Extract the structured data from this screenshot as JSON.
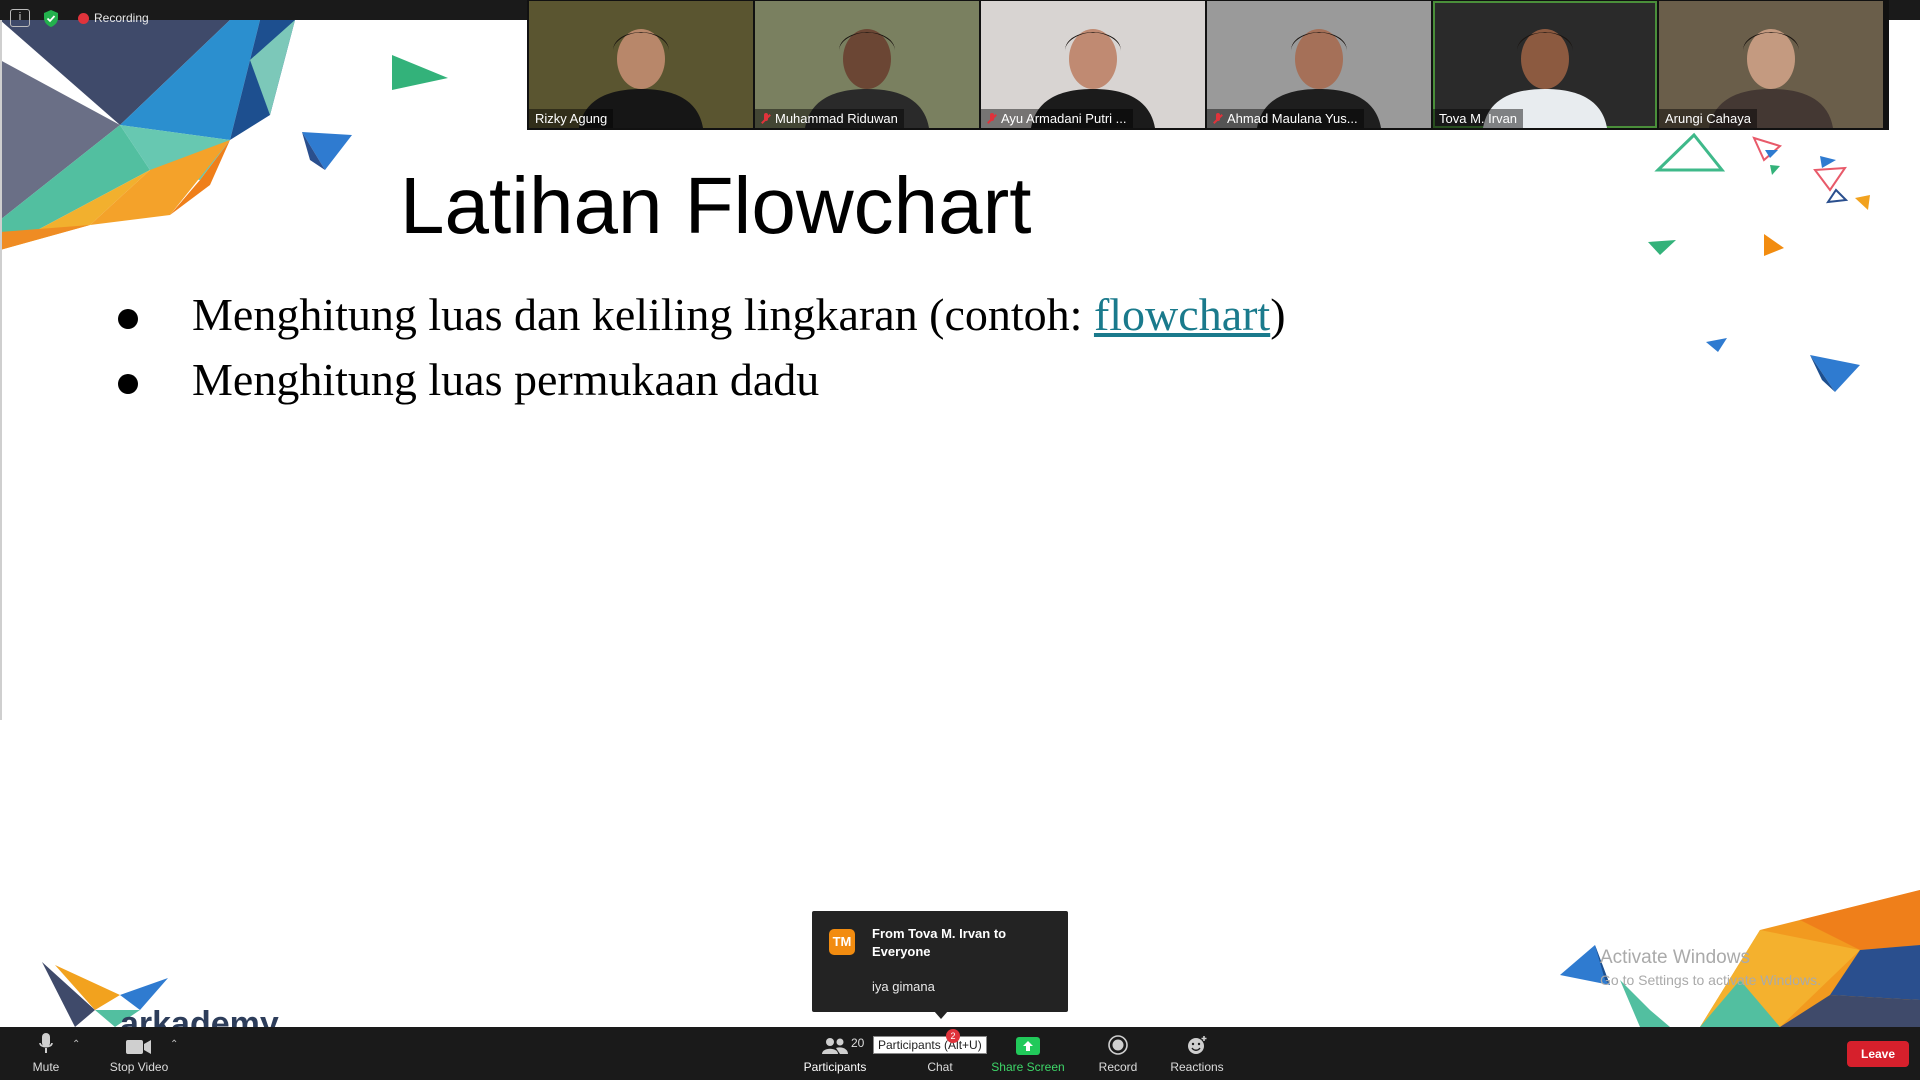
{
  "topbar": {
    "recording_label": "Recording",
    "info_glyph": "i"
  },
  "videos": [
    {
      "name": "Rizky Agung",
      "muted": false,
      "bg": "#5a5530",
      "skin": "#b8876a",
      "shirt": "#161616"
    },
    {
      "name": "Muhammad Riduwan",
      "muted": true,
      "bg": "#7a8060",
      "skin": "#6b4634",
      "shirt": "#2a2a2a"
    },
    {
      "name": "Ayu Armadani Putri ...",
      "muted": true,
      "bg": "#d8d4d2",
      "skin": "#c08a72",
      "shirt": "#1b1b1b"
    },
    {
      "name": "Ahmad Maulana Yus...",
      "muted": true,
      "bg": "#9a9a9a",
      "skin": "#a57058",
      "shirt": "#1e1e1e"
    },
    {
      "name": "Tova M. Irvan",
      "muted": false,
      "bg": "#2a2a2a",
      "skin": "#8c5a40",
      "shirt": "#e8ecef",
      "active": true
    },
    {
      "name": "Arungi Cahaya",
      "muted": false,
      "bg": "#6a5e4a",
      "skin": "#c49a80",
      "shirt": "#443833"
    }
  ],
  "slide": {
    "title": "Latihan Flowchart",
    "bullet1_text": "Menghitung luas dan keliling lingkaran (contoh: ",
    "bullet1_link": "flowchart",
    "bullet1_end": ")",
    "bullet2_text": "Menghitung luas permukaan dadu",
    "logo_text": "arkademy",
    "watermark_title": "Activate Windows",
    "watermark_sub": "Go to Settings to activate Windows."
  },
  "toast": {
    "avatar": "TM",
    "from": "From Tova M. Irvan to Everyone",
    "message": "iya gimana"
  },
  "toolbar": {
    "mute": "Mute",
    "stop_video": "Stop Video",
    "participants": "Participants",
    "participants_count": "20",
    "participants_tooltip": "Participants (Alt+U)",
    "chat": "Chat",
    "chat_badge": "2",
    "share_screen": "Share Screen",
    "record": "Record",
    "reactions": "Reactions",
    "leave": "Leave"
  }
}
